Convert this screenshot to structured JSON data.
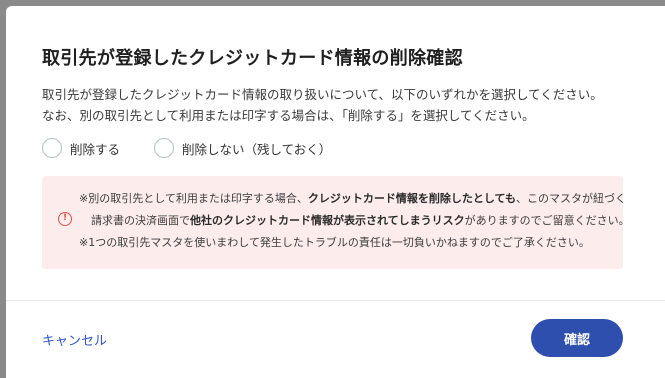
{
  "dialog": {
    "title": "取引先が登録したクレジットカード情報の削除確認",
    "description_line1": "取引先が登録したクレジットカード情報の取り扱いについて、以下のいずれかを選択してください。",
    "description_line2": "なお、別の取引先として利用または印字する場合は、「削除する」を選択してください。"
  },
  "options": [
    {
      "label": "削除する",
      "selected": false
    },
    {
      "label": "削除しない（残しておく）",
      "selected": false
    }
  ],
  "alert": {
    "icon": "exclamation-circle-icon",
    "color": "#d9534f",
    "line1_a": "※別の取引先として利用または印字する場合、",
    "line1_b": "クレジットカード情報を削除したとしても",
    "line1_c": "、このマスタが紐づく",
    "line2_a": "請求書の決済画面で",
    "line2_b": "他社のクレジットカード情報が表示されてしまうリスク",
    "line2_c": "がありますのでご留意ください。",
    "line3": "※1つの取引先マスタを使いまわして発生したトラブルの責任は一切負いかねますのでご了承ください。"
  },
  "footer": {
    "cancel_label": "キャンセル",
    "confirm_label": "確認",
    "accent_color": "#2f4fae"
  }
}
